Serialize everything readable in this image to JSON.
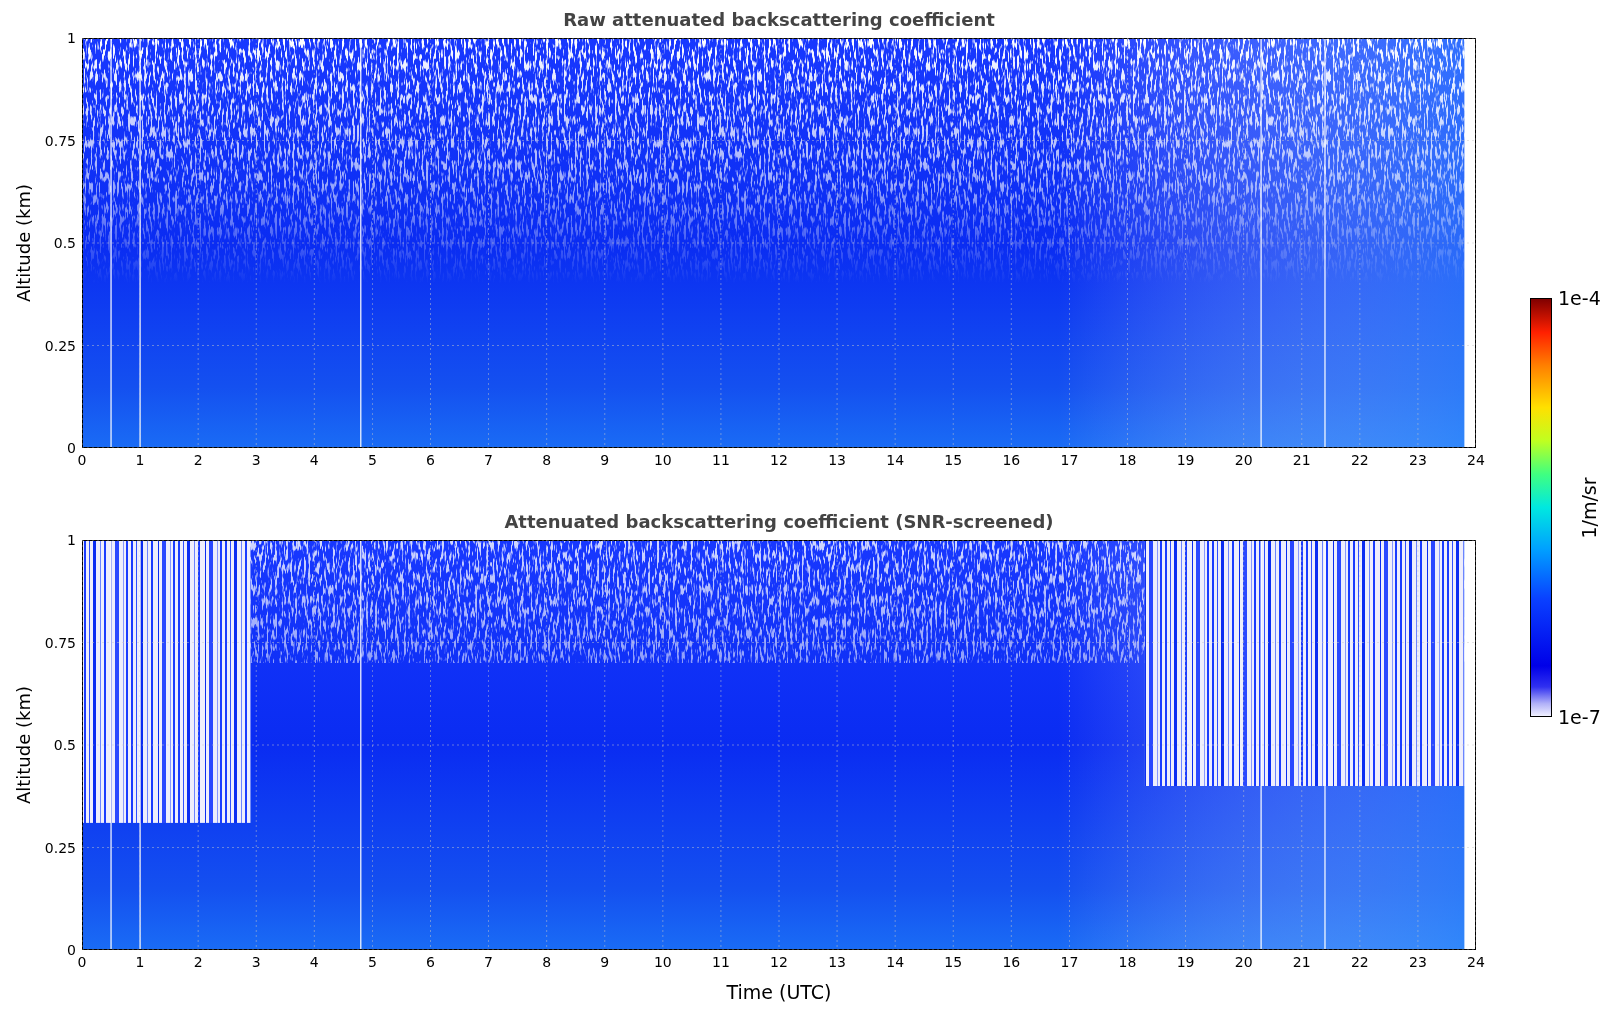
{
  "panels": [
    {
      "title": "Raw attenuated backscattering coefficient",
      "ylabel": "Altitude (km)",
      "kind": "raw",
      "yticks": [
        "1",
        "0.75",
        "0.5",
        "0.25",
        "0"
      ],
      "xticks": [
        "0",
        "1",
        "2",
        "3",
        "4",
        "5",
        "6",
        "7",
        "8",
        "9",
        "10",
        "11",
        "12",
        "13",
        "14",
        "15",
        "16",
        "17",
        "18",
        "19",
        "20",
        "21",
        "22",
        "23",
        "24"
      ]
    },
    {
      "title": "Attenuated backscattering coefficient (SNR-screened)",
      "ylabel": "Altitude (km)",
      "kind": "screened",
      "yticks": [
        "1",
        "0.75",
        "0.5",
        "0.25",
        "0"
      ],
      "xticks": [
        "0",
        "1",
        "2",
        "3",
        "4",
        "5",
        "6",
        "7",
        "8",
        "9",
        "10",
        "11",
        "12",
        "13",
        "14",
        "15",
        "16",
        "17",
        "18",
        "19",
        "20",
        "21",
        "22",
        "23",
        "24"
      ],
      "xlabel": "Time (UTC)"
    }
  ],
  "colorbar": {
    "max": "1e-4",
    "min": "1e-7",
    "label": "1/m/sr"
  }
}
